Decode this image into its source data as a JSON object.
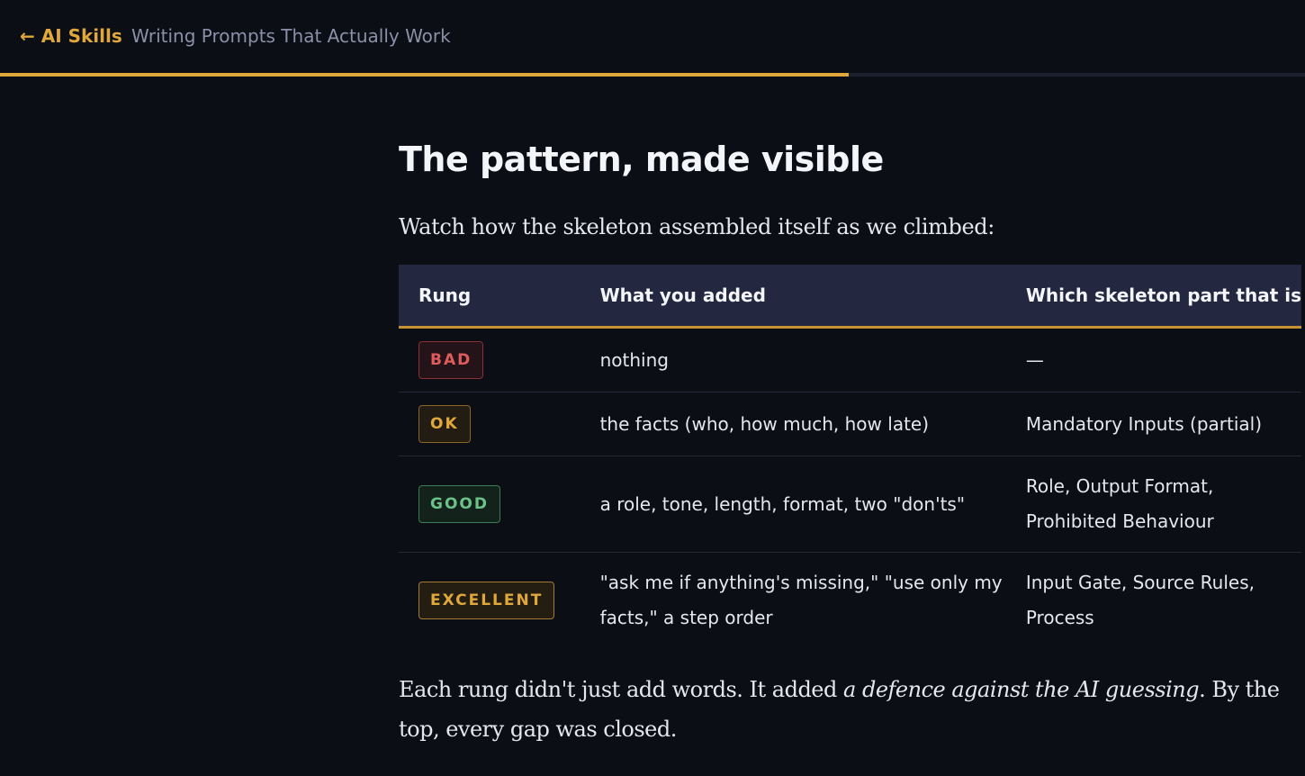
{
  "nav": {
    "back_label": "← AI Skills",
    "page_title": "Writing Prompts That Actually Work",
    "progress_percent": 65
  },
  "section": {
    "title": "The pattern, made visible",
    "intro": "Watch how the skeleton assembled itself as we climbed:"
  },
  "table": {
    "headers": [
      "Rung",
      "What you added",
      "Which skeleton part that is"
    ],
    "rows": [
      {
        "rung": "BAD",
        "added": "nothing",
        "part": "—"
      },
      {
        "rung": "OK",
        "added": "the facts (who, how much, how late)",
        "part": "Mandatory Inputs (partial)"
      },
      {
        "rung": "GOOD",
        "added": "a role, tone, length, format, two \"don'ts\"",
        "part": "Role, Output Format, Prohibited Behaviour"
      },
      {
        "rung": "EXCELLENT",
        "added": "\"ask me if anything's missing,\" \"use only my facts,\" a step order",
        "part": "Input Gate, Source Rules, Process"
      }
    ]
  },
  "outro": {
    "before": "Each rung didn't just add words. It added ",
    "emphasis": "a defence against the AI guessing",
    "after": ". By the top, every gap was closed."
  },
  "colors": {
    "accent": "#e0a73a",
    "background": "#0c0e16",
    "bad": "#e05c5c",
    "good": "#6cc38a"
  }
}
